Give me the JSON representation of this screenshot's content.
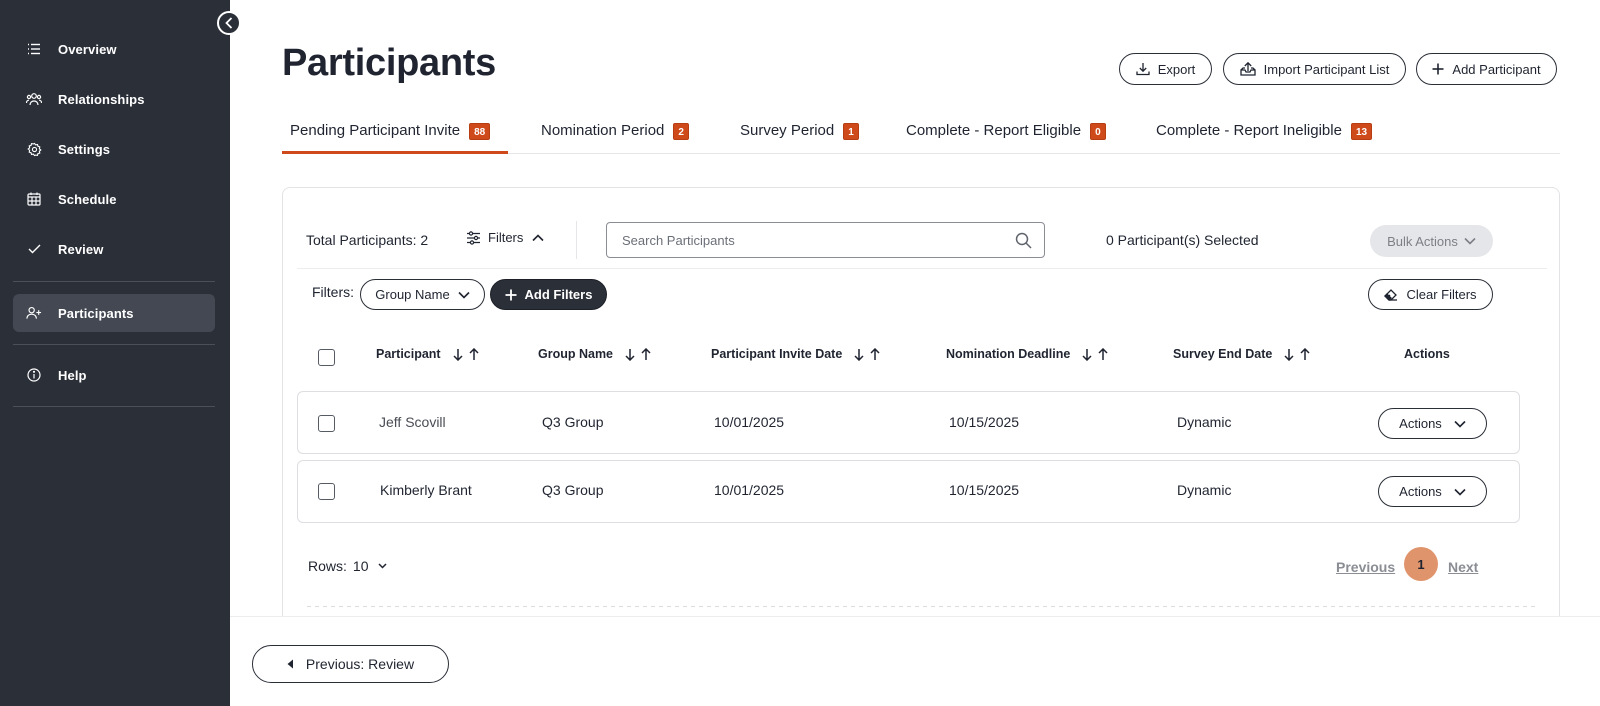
{
  "sidebar": {
    "items": [
      {
        "label": "Overview",
        "icon": "list-icon"
      },
      {
        "label": "Relationships",
        "icon": "people-icon"
      },
      {
        "label": "Settings",
        "icon": "gear-icon"
      },
      {
        "label": "Schedule",
        "icon": "calendar-icon"
      },
      {
        "label": "Review",
        "icon": "check-icon"
      },
      {
        "label": "Participants",
        "icon": "add-person-icon",
        "active": true
      },
      {
        "label": "Help",
        "icon": "info-icon"
      }
    ]
  },
  "header": {
    "title": "Participants",
    "export_label": "Export",
    "import_label": "Import Participant List",
    "add_label": "Add Participant"
  },
  "tabs": [
    {
      "label": "Pending Participant Invite",
      "count": "88",
      "active": true
    },
    {
      "label": "Nomination Period",
      "count": "2"
    },
    {
      "label": "Survey Period",
      "count": "1"
    },
    {
      "label": "Complete - Report Eligible",
      "count": "0"
    },
    {
      "label": "Complete - Report Ineligible",
      "count": "13"
    }
  ],
  "toolbar": {
    "total": "Total Participants: 2",
    "filters_label": "Filters",
    "search_placeholder": "Search Participants",
    "selected": "0 Participant(s) Selected",
    "bulk_label": "Bulk Actions"
  },
  "filters": {
    "label": "Filters:",
    "group_name": "Group Name",
    "add_label": "Add Filters",
    "clear_label": "Clear Filters"
  },
  "table": {
    "columns": [
      "Participant",
      "Group Name",
      "Participant Invite Date",
      "Nomination Deadline",
      "Survey End Date",
      "Actions"
    ],
    "rows": [
      {
        "participant": "Jeff Scovill",
        "group": "Q3 Group",
        "invite_date": "10/01/2025",
        "nomination_deadline": "10/15/2025",
        "survey_end": "Dynamic",
        "action": "Actions"
      },
      {
        "participant": "Kimberly Brant",
        "group": "Q3 Group",
        "invite_date": "10/01/2025",
        "nomination_deadline": "10/15/2025",
        "survey_end": "Dynamic",
        "action": "Actions"
      }
    ]
  },
  "pagination": {
    "rows_label": "Rows:",
    "rows_value": "10",
    "previous": "Previous",
    "page": "1",
    "next": "Next"
  },
  "footer": {
    "previous_step": "Previous: Review"
  },
  "colors": {
    "sidebar_bg": "#2b2f38",
    "accent": "#cf4a1b",
    "page_active": "#e0946b"
  }
}
